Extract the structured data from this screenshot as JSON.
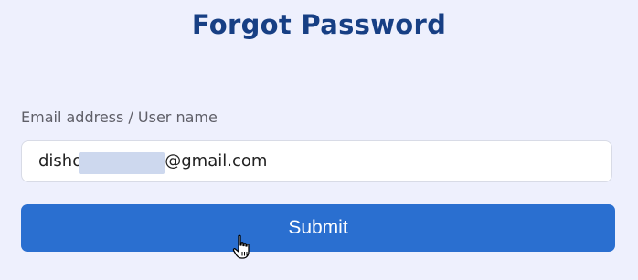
{
  "page": {
    "title": "Forgot Password"
  },
  "form": {
    "email_label": "Email address / User name",
    "email_value_prefix": "disho",
    "email_value_suffix": "@gmail.com",
    "submit_label": "Submit"
  },
  "colors": {
    "background": "#eef0fd",
    "title": "#173f84",
    "button": "#2a6fd0",
    "redaction": "#cdd8ee"
  },
  "icons": {
    "cursor": "hand-pointer-icon"
  }
}
